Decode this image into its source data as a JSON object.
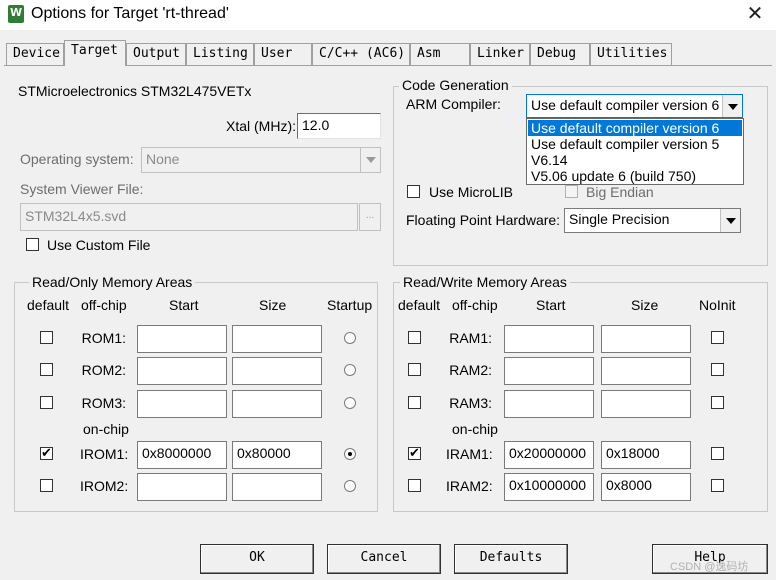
{
  "window": {
    "title": "Options for Target 'rt-thread'",
    "close": "✕"
  },
  "tabs": [
    "Device",
    "Target",
    "Output",
    "Listing",
    "User",
    "C/C++ (AC6)",
    "Asm",
    "Linker",
    "Debug",
    "Utilities"
  ],
  "active_tab": "Target",
  "device": {
    "name": "STMicroelectronics STM32L475VETx"
  },
  "xtal": {
    "label": "Xtal (MHz):",
    "value": "12.0"
  },
  "os": {
    "label": "Operating system:",
    "value": "None"
  },
  "svf": {
    "label": "System Viewer File:",
    "value": "STM32L4x5.svd",
    "browse": "..."
  },
  "custom_file": {
    "label": "Use Custom File",
    "checked": false
  },
  "code_gen": {
    "title": "Code Generation",
    "compiler_label": "ARM Compiler:",
    "compiler_value": "Use default compiler version 6",
    "compiler_options": [
      "Use default compiler version 6",
      "Use default compiler version 5",
      "V6.14",
      "V5.06 update 6 (build 750)"
    ],
    "selected_option_index": 0,
    "microlib_label": "Use MicroLIB",
    "microlib_checked": false,
    "big_endian_label": "Big Endian",
    "big_endian_checked": false,
    "fpu_label": "Floating Point Hardware:",
    "fpu_value": "Single Precision"
  },
  "ro_memory": {
    "title": "Read/Only Memory Areas",
    "headers": {
      "default": "default",
      "offchip": "off-chip",
      "start": "Start",
      "size": "Size",
      "startup": "Startup"
    },
    "onchip_label": "on-chip",
    "rows": [
      {
        "name": "ROM1:",
        "default": false,
        "start": "",
        "size": "",
        "startup": false
      },
      {
        "name": "ROM2:",
        "default": false,
        "start": "",
        "size": "",
        "startup": false
      },
      {
        "name": "ROM3:",
        "default": false,
        "start": "",
        "size": "",
        "startup": false
      },
      {
        "name": "IROM1:",
        "default": true,
        "start": "0x8000000",
        "size": "0x80000",
        "startup": true
      },
      {
        "name": "IROM2:",
        "default": false,
        "start": "",
        "size": "",
        "startup": false
      }
    ]
  },
  "rw_memory": {
    "title": "Read/Write Memory Areas",
    "headers": {
      "default": "default",
      "offchip": "off-chip",
      "start": "Start",
      "size": "Size",
      "noinit": "NoInit"
    },
    "onchip_label": "on-chip",
    "rows": [
      {
        "name": "RAM1:",
        "default": false,
        "start": "",
        "size": "",
        "noinit": false
      },
      {
        "name": "RAM2:",
        "default": false,
        "start": "",
        "size": "",
        "noinit": false
      },
      {
        "name": "RAM3:",
        "default": false,
        "start": "",
        "size": "",
        "noinit": false
      },
      {
        "name": "IRAM1:",
        "default": true,
        "start": "0x20000000",
        "size": "0x18000",
        "noinit": false
      },
      {
        "name": "IRAM2:",
        "default": false,
        "start": "0x10000000",
        "size": "0x8000",
        "noinit": false
      }
    ]
  },
  "buttons": {
    "ok": "OK",
    "cancel": "Cancel",
    "defaults": "Defaults",
    "help": "Help"
  },
  "watermark": "CSDN @逸码坊"
}
